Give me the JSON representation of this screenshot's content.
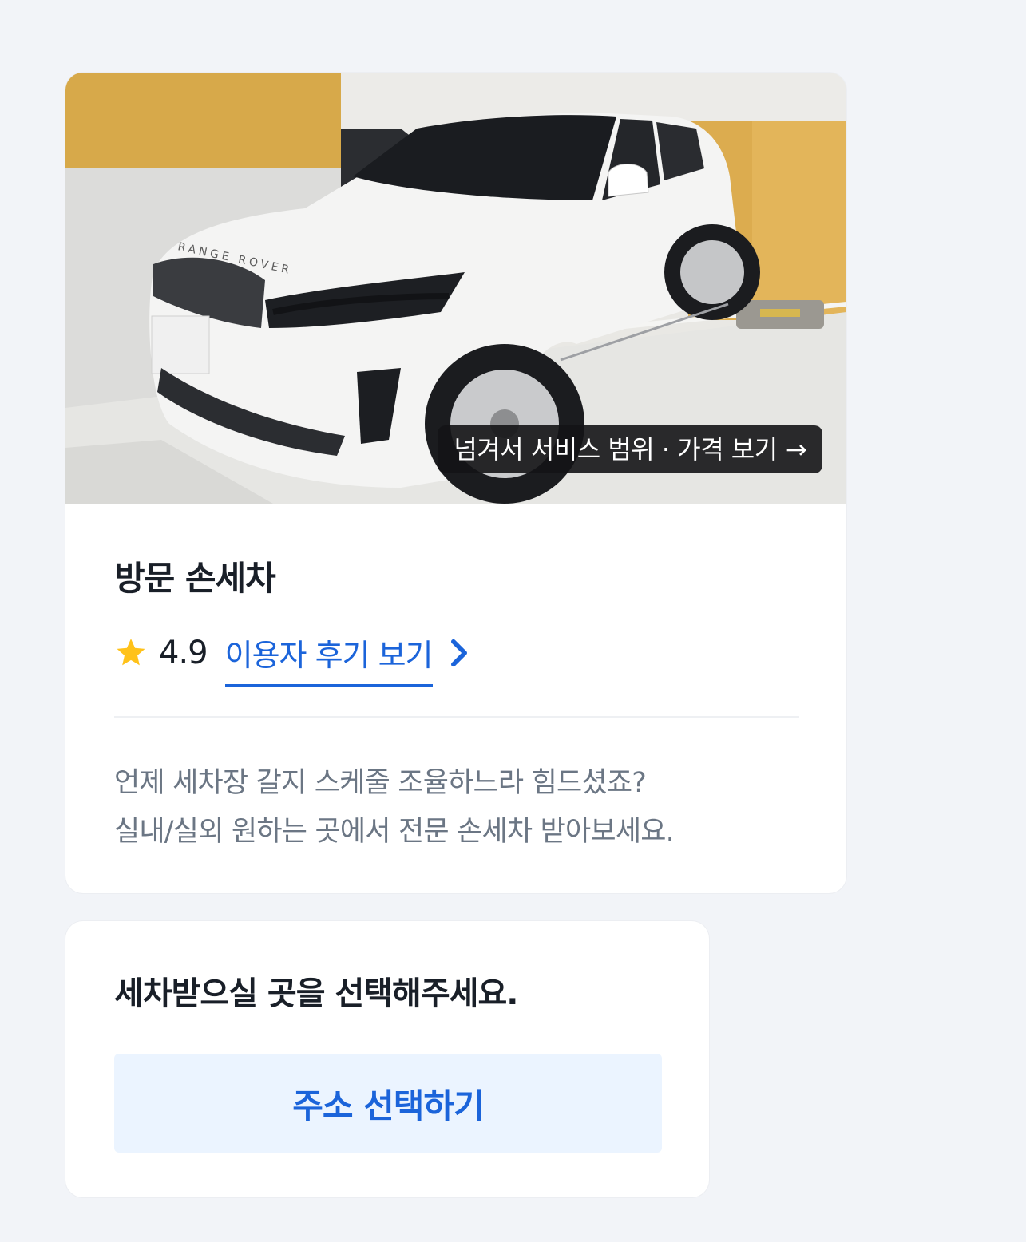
{
  "service": {
    "photo_hint": "넘겨서 서비스 범위 · 가격 보기",
    "photo_hint_arrow": "→",
    "badge_text": "RANGE ROVER",
    "title": "방문 손세차",
    "rating": "4.9",
    "review_link": "이용자 후기 보기",
    "description_line1": "언제 세차장 갈지 스케줄 조율하느라 힘드셨죠?",
    "description_line2": "실내/실외 원하는 곳에서 전문 손세차 받아보세요."
  },
  "address": {
    "title": "세차받으실 곳을 선택해주세요.",
    "button_label": "주소 선택하기"
  },
  "colors": {
    "background": "#f2f4f8",
    "accent": "#1b64da",
    "star": "#ffc21a",
    "button_bg": "#ebf4ff"
  },
  "icons": [
    "star-icon",
    "chevron-right-icon",
    "arrow-right-icon"
  ]
}
